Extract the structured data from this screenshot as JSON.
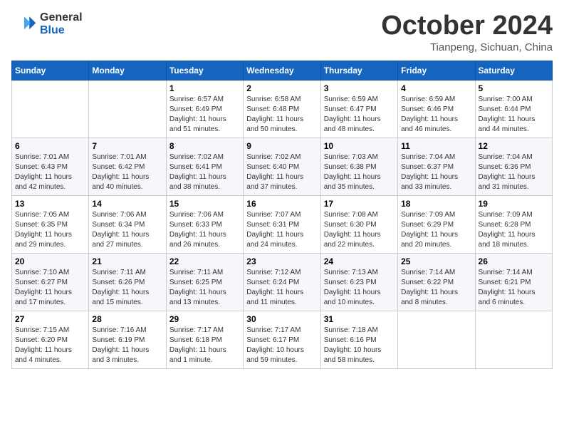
{
  "header": {
    "logo_general": "General",
    "logo_blue": "Blue",
    "month_title": "October 2024",
    "location": "Tianpeng, Sichuan, China"
  },
  "days_of_week": [
    "Sunday",
    "Monday",
    "Tuesday",
    "Wednesday",
    "Thursday",
    "Friday",
    "Saturday"
  ],
  "weeks": [
    [
      {
        "day": "",
        "info": ""
      },
      {
        "day": "",
        "info": ""
      },
      {
        "day": "1",
        "info": "Sunrise: 6:57 AM\nSunset: 6:49 PM\nDaylight: 11 hours\nand 51 minutes."
      },
      {
        "day": "2",
        "info": "Sunrise: 6:58 AM\nSunset: 6:48 PM\nDaylight: 11 hours\nand 50 minutes."
      },
      {
        "day": "3",
        "info": "Sunrise: 6:59 AM\nSunset: 6:47 PM\nDaylight: 11 hours\nand 48 minutes."
      },
      {
        "day": "4",
        "info": "Sunrise: 6:59 AM\nSunset: 6:46 PM\nDaylight: 11 hours\nand 46 minutes."
      },
      {
        "day": "5",
        "info": "Sunrise: 7:00 AM\nSunset: 6:44 PM\nDaylight: 11 hours\nand 44 minutes."
      }
    ],
    [
      {
        "day": "6",
        "info": "Sunrise: 7:01 AM\nSunset: 6:43 PM\nDaylight: 11 hours\nand 42 minutes."
      },
      {
        "day": "7",
        "info": "Sunrise: 7:01 AM\nSunset: 6:42 PM\nDaylight: 11 hours\nand 40 minutes."
      },
      {
        "day": "8",
        "info": "Sunrise: 7:02 AM\nSunset: 6:41 PM\nDaylight: 11 hours\nand 38 minutes."
      },
      {
        "day": "9",
        "info": "Sunrise: 7:02 AM\nSunset: 6:40 PM\nDaylight: 11 hours\nand 37 minutes."
      },
      {
        "day": "10",
        "info": "Sunrise: 7:03 AM\nSunset: 6:38 PM\nDaylight: 11 hours\nand 35 minutes."
      },
      {
        "day": "11",
        "info": "Sunrise: 7:04 AM\nSunset: 6:37 PM\nDaylight: 11 hours\nand 33 minutes."
      },
      {
        "day": "12",
        "info": "Sunrise: 7:04 AM\nSunset: 6:36 PM\nDaylight: 11 hours\nand 31 minutes."
      }
    ],
    [
      {
        "day": "13",
        "info": "Sunrise: 7:05 AM\nSunset: 6:35 PM\nDaylight: 11 hours\nand 29 minutes."
      },
      {
        "day": "14",
        "info": "Sunrise: 7:06 AM\nSunset: 6:34 PM\nDaylight: 11 hours\nand 27 minutes."
      },
      {
        "day": "15",
        "info": "Sunrise: 7:06 AM\nSunset: 6:33 PM\nDaylight: 11 hours\nand 26 minutes."
      },
      {
        "day": "16",
        "info": "Sunrise: 7:07 AM\nSunset: 6:31 PM\nDaylight: 11 hours\nand 24 minutes."
      },
      {
        "day": "17",
        "info": "Sunrise: 7:08 AM\nSunset: 6:30 PM\nDaylight: 11 hours\nand 22 minutes."
      },
      {
        "day": "18",
        "info": "Sunrise: 7:09 AM\nSunset: 6:29 PM\nDaylight: 11 hours\nand 20 minutes."
      },
      {
        "day": "19",
        "info": "Sunrise: 7:09 AM\nSunset: 6:28 PM\nDaylight: 11 hours\nand 18 minutes."
      }
    ],
    [
      {
        "day": "20",
        "info": "Sunrise: 7:10 AM\nSunset: 6:27 PM\nDaylight: 11 hours\nand 17 minutes."
      },
      {
        "day": "21",
        "info": "Sunrise: 7:11 AM\nSunset: 6:26 PM\nDaylight: 11 hours\nand 15 minutes."
      },
      {
        "day": "22",
        "info": "Sunrise: 7:11 AM\nSunset: 6:25 PM\nDaylight: 11 hours\nand 13 minutes."
      },
      {
        "day": "23",
        "info": "Sunrise: 7:12 AM\nSunset: 6:24 PM\nDaylight: 11 hours\nand 11 minutes."
      },
      {
        "day": "24",
        "info": "Sunrise: 7:13 AM\nSunset: 6:23 PM\nDaylight: 11 hours\nand 10 minutes."
      },
      {
        "day": "25",
        "info": "Sunrise: 7:14 AM\nSunset: 6:22 PM\nDaylight: 11 hours\nand 8 minutes."
      },
      {
        "day": "26",
        "info": "Sunrise: 7:14 AM\nSunset: 6:21 PM\nDaylight: 11 hours\nand 6 minutes."
      }
    ],
    [
      {
        "day": "27",
        "info": "Sunrise: 7:15 AM\nSunset: 6:20 PM\nDaylight: 11 hours\nand 4 minutes."
      },
      {
        "day": "28",
        "info": "Sunrise: 7:16 AM\nSunset: 6:19 PM\nDaylight: 11 hours\nand 3 minutes."
      },
      {
        "day": "29",
        "info": "Sunrise: 7:17 AM\nSunset: 6:18 PM\nDaylight: 11 hours\nand 1 minute."
      },
      {
        "day": "30",
        "info": "Sunrise: 7:17 AM\nSunset: 6:17 PM\nDaylight: 10 hours\nand 59 minutes."
      },
      {
        "day": "31",
        "info": "Sunrise: 7:18 AM\nSunset: 6:16 PM\nDaylight: 10 hours\nand 58 minutes."
      },
      {
        "day": "",
        "info": ""
      },
      {
        "day": "",
        "info": ""
      }
    ]
  ]
}
